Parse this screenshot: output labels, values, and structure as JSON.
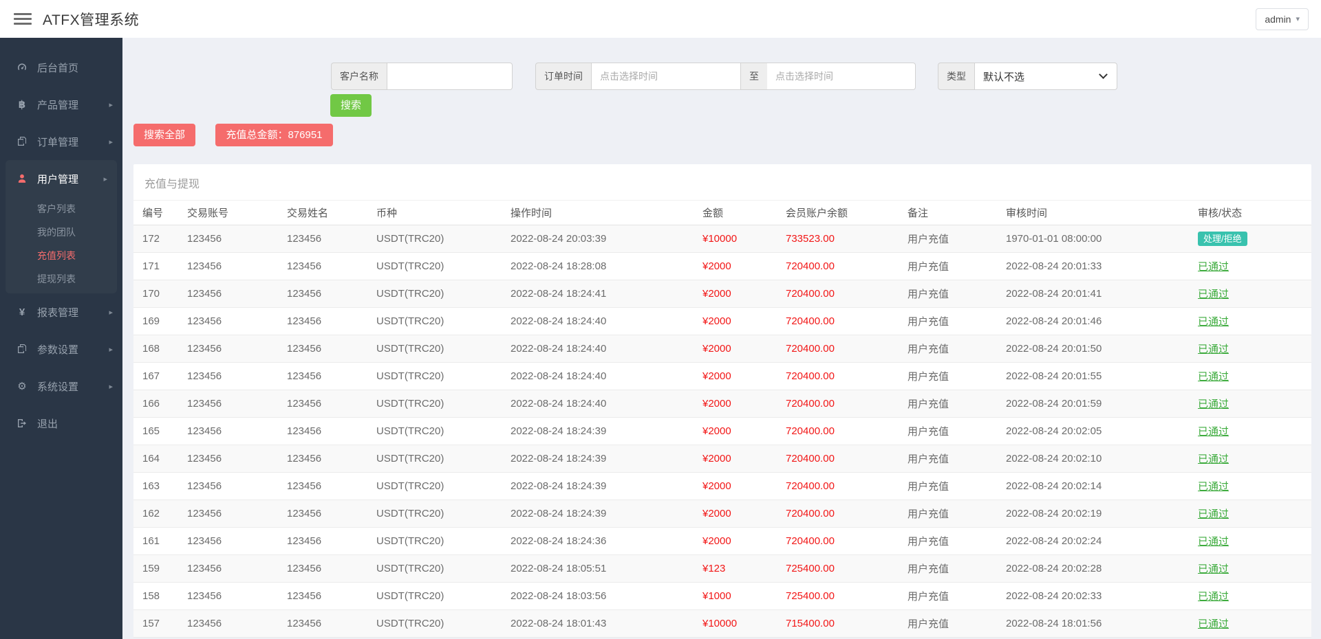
{
  "header": {
    "title": "ATFX管理系统",
    "user": "admin"
  },
  "sidebar": {
    "items": [
      {
        "label": "后台首页",
        "icon": "dashboard-icon",
        "expandable": false,
        "active": false
      },
      {
        "label": "产品管理",
        "icon": "bitcoin-icon",
        "expandable": true,
        "active": false
      },
      {
        "label": "订单管理",
        "icon": "orders-icon",
        "expandable": true,
        "active": false
      },
      {
        "label": "用户管理",
        "icon": "user-icon",
        "expandable": true,
        "active": true,
        "children": [
          {
            "label": "客户列表",
            "active": false
          },
          {
            "label": "我的团队",
            "active": false
          },
          {
            "label": "充值列表",
            "active": true
          },
          {
            "label": "提现列表",
            "active": false
          }
        ]
      },
      {
        "label": "报表管理",
        "icon": "yen-icon",
        "expandable": true,
        "active": false
      },
      {
        "label": "参数设置",
        "icon": "params-icon",
        "expandable": true,
        "active": false
      },
      {
        "label": "系统设置",
        "icon": "gears-icon",
        "expandable": true,
        "active": false
      },
      {
        "label": "退出",
        "icon": "logout-icon",
        "expandable": false,
        "active": false
      }
    ]
  },
  "filters": {
    "customer_name_label": "客户名称",
    "customer_name_value": "",
    "order_time_label": "订单时间",
    "date_placeholder": "点击选择时间",
    "to_label": "至",
    "type_label": "类型",
    "type_value": "默认不选",
    "search_button": "搜索",
    "search_all_button": "搜索全部",
    "total_amount_button": "充值总金额：876951"
  },
  "panel": {
    "title": "充值与提现",
    "columns": [
      "编号",
      "交易账号",
      "交易姓名",
      "币种",
      "操作时间",
      "金额",
      "会员账户余额",
      "备注",
      "审核时间",
      "审核/状态"
    ],
    "rows": [
      {
        "id": "172",
        "account": "123456",
        "name": "123456",
        "currency": "USDT(TRC20)",
        "op_time": "2022-08-24 20:03:39",
        "amount": "¥10000",
        "balance": "733523.00",
        "remark": "用户充值",
        "audit_time": "1970-01-01 08:00:00",
        "status": "处理/拒绝",
        "status_type": "badge"
      },
      {
        "id": "171",
        "account": "123456",
        "name": "123456",
        "currency": "USDT(TRC20)",
        "op_time": "2022-08-24 18:28:08",
        "amount": "¥2000",
        "balance": "720400.00",
        "remark": "用户充值",
        "audit_time": "2022-08-24 20:01:33",
        "status": "已通过",
        "status_type": "pass"
      },
      {
        "id": "170",
        "account": "123456",
        "name": "123456",
        "currency": "USDT(TRC20)",
        "op_time": "2022-08-24 18:24:41",
        "amount": "¥2000",
        "balance": "720400.00",
        "remark": "用户充值",
        "audit_time": "2022-08-24 20:01:41",
        "status": "已通过",
        "status_type": "pass"
      },
      {
        "id": "169",
        "account": "123456",
        "name": "123456",
        "currency": "USDT(TRC20)",
        "op_time": "2022-08-24 18:24:40",
        "amount": "¥2000",
        "balance": "720400.00",
        "remark": "用户充值",
        "audit_time": "2022-08-24 20:01:46",
        "status": "已通过",
        "status_type": "pass"
      },
      {
        "id": "168",
        "account": "123456",
        "name": "123456",
        "currency": "USDT(TRC20)",
        "op_time": "2022-08-24 18:24:40",
        "amount": "¥2000",
        "balance": "720400.00",
        "remark": "用户充值",
        "audit_time": "2022-08-24 20:01:50",
        "status": "已通过",
        "status_type": "pass"
      },
      {
        "id": "167",
        "account": "123456",
        "name": "123456",
        "currency": "USDT(TRC20)",
        "op_time": "2022-08-24 18:24:40",
        "amount": "¥2000",
        "balance": "720400.00",
        "remark": "用户充值",
        "audit_time": "2022-08-24 20:01:55",
        "status": "已通过",
        "status_type": "pass"
      },
      {
        "id": "166",
        "account": "123456",
        "name": "123456",
        "currency": "USDT(TRC20)",
        "op_time": "2022-08-24 18:24:40",
        "amount": "¥2000",
        "balance": "720400.00",
        "remark": "用户充值",
        "audit_time": "2022-08-24 20:01:59",
        "status": "已通过",
        "status_type": "pass"
      },
      {
        "id": "165",
        "account": "123456",
        "name": "123456",
        "currency": "USDT(TRC20)",
        "op_time": "2022-08-24 18:24:39",
        "amount": "¥2000",
        "balance": "720400.00",
        "remark": "用户充值",
        "audit_time": "2022-08-24 20:02:05",
        "status": "已通过",
        "status_type": "pass"
      },
      {
        "id": "164",
        "account": "123456",
        "name": "123456",
        "currency": "USDT(TRC20)",
        "op_time": "2022-08-24 18:24:39",
        "amount": "¥2000",
        "balance": "720400.00",
        "remark": "用户充值",
        "audit_time": "2022-08-24 20:02:10",
        "status": "已通过",
        "status_type": "pass"
      },
      {
        "id": "163",
        "account": "123456",
        "name": "123456",
        "currency": "USDT(TRC20)",
        "op_time": "2022-08-24 18:24:39",
        "amount": "¥2000",
        "balance": "720400.00",
        "remark": "用户充值",
        "audit_time": "2022-08-24 20:02:14",
        "status": "已通过",
        "status_type": "pass"
      },
      {
        "id": "162",
        "account": "123456",
        "name": "123456",
        "currency": "USDT(TRC20)",
        "op_time": "2022-08-24 18:24:39",
        "amount": "¥2000",
        "balance": "720400.00",
        "remark": "用户充值",
        "audit_time": "2022-08-24 20:02:19",
        "status": "已通过",
        "status_type": "pass"
      },
      {
        "id": "161",
        "account": "123456",
        "name": "123456",
        "currency": "USDT(TRC20)",
        "op_time": "2022-08-24 18:24:36",
        "amount": "¥2000",
        "balance": "720400.00",
        "remark": "用户充值",
        "audit_time": "2022-08-24 20:02:24",
        "status": "已通过",
        "status_type": "pass"
      },
      {
        "id": "159",
        "account": "123456",
        "name": "123456",
        "currency": "USDT(TRC20)",
        "op_time": "2022-08-24 18:05:51",
        "amount": "¥123",
        "balance": "725400.00",
        "remark": "用户充值",
        "audit_time": "2022-08-24 20:02:28",
        "status": "已通过",
        "status_type": "pass"
      },
      {
        "id": "158",
        "account": "123456",
        "name": "123456",
        "currency": "USDT(TRC20)",
        "op_time": "2022-08-24 18:03:56",
        "amount": "¥1000",
        "balance": "725400.00",
        "remark": "用户充值",
        "audit_time": "2022-08-24 20:02:33",
        "status": "已通过",
        "status_type": "pass"
      },
      {
        "id": "157",
        "account": "123456",
        "name": "123456",
        "currency": "USDT(TRC20)",
        "op_time": "2022-08-24 18:01:43",
        "amount": "¥10000",
        "balance": "715400.00",
        "remark": "用户充值",
        "audit_time": "2022-08-24 18:01:56",
        "status": "已通过",
        "status_type": "pass"
      }
    ]
  },
  "colors": {
    "accent_red": "#f56c6c",
    "accent_green": "#71c845",
    "badge_teal": "#39c2ae",
    "pass_green": "#3cab3c",
    "value_red": "#f21616",
    "sidebar_bg": "#2a3646"
  }
}
